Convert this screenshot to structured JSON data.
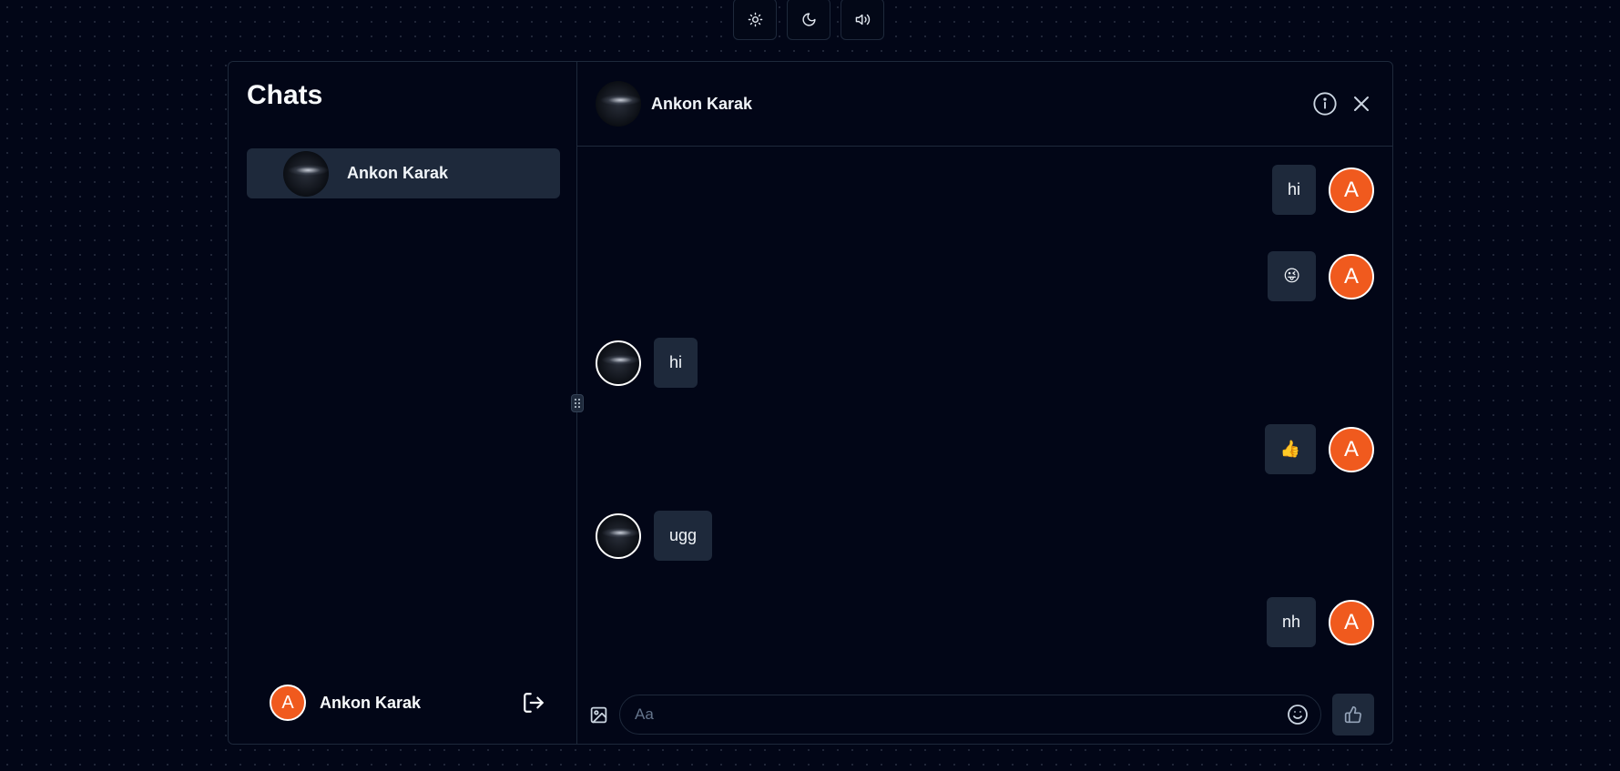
{
  "toolbar": {
    "light_icon": "sun-icon",
    "dark_icon": "moon-icon",
    "sound_icon": "speaker-icon"
  },
  "sidebar": {
    "title": "Chats",
    "chats": [
      {
        "name": "Ankon Karak",
        "avatar": "night-sky-photo"
      }
    ],
    "current_user": {
      "initial": "A",
      "name": "Ankon Karak",
      "avatar_color": "#f05a1e"
    }
  },
  "conversation": {
    "contact_name": "Ankon Karak",
    "messages": [
      {
        "from": "me",
        "text": "hi"
      },
      {
        "from": "me",
        "text": "😜"
      },
      {
        "from": "them",
        "text": "hi"
      },
      {
        "from": "me",
        "text": "👍"
      },
      {
        "from": "them",
        "text": "ugg"
      },
      {
        "from": "me",
        "text": "nh"
      }
    ],
    "my_initial": "A"
  },
  "composer": {
    "placeholder": "Aa"
  },
  "colors": {
    "background": "#020617",
    "panel_border": "#1e293b",
    "bubble": "#1e293b",
    "accent_avatar": "#f05a1e"
  }
}
